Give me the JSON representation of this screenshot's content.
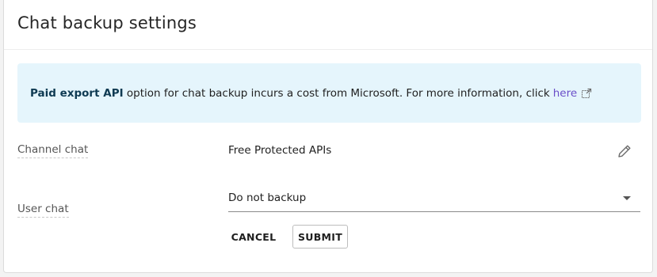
{
  "page": {
    "title": "Chat backup settings"
  },
  "banner": {
    "bold_text": "Paid export API",
    "text": " option for chat backup incurs a cost from Microsoft. For more information, click",
    "link_text": "here",
    "link_icon": "external-link-icon",
    "bg_color": "#e5f5fc",
    "link_color": "#6a4ec8"
  },
  "channel_chat": {
    "label": "Channel chat",
    "value": "Free Protected APIs",
    "edit_icon": "pencil-icon"
  },
  "user_chat": {
    "label": "User chat",
    "selected": "Do not backup",
    "caret_icon": "caret-down-icon"
  },
  "actions": {
    "cancel_label": "CANCEL",
    "submit_label": "SUBMIT"
  }
}
